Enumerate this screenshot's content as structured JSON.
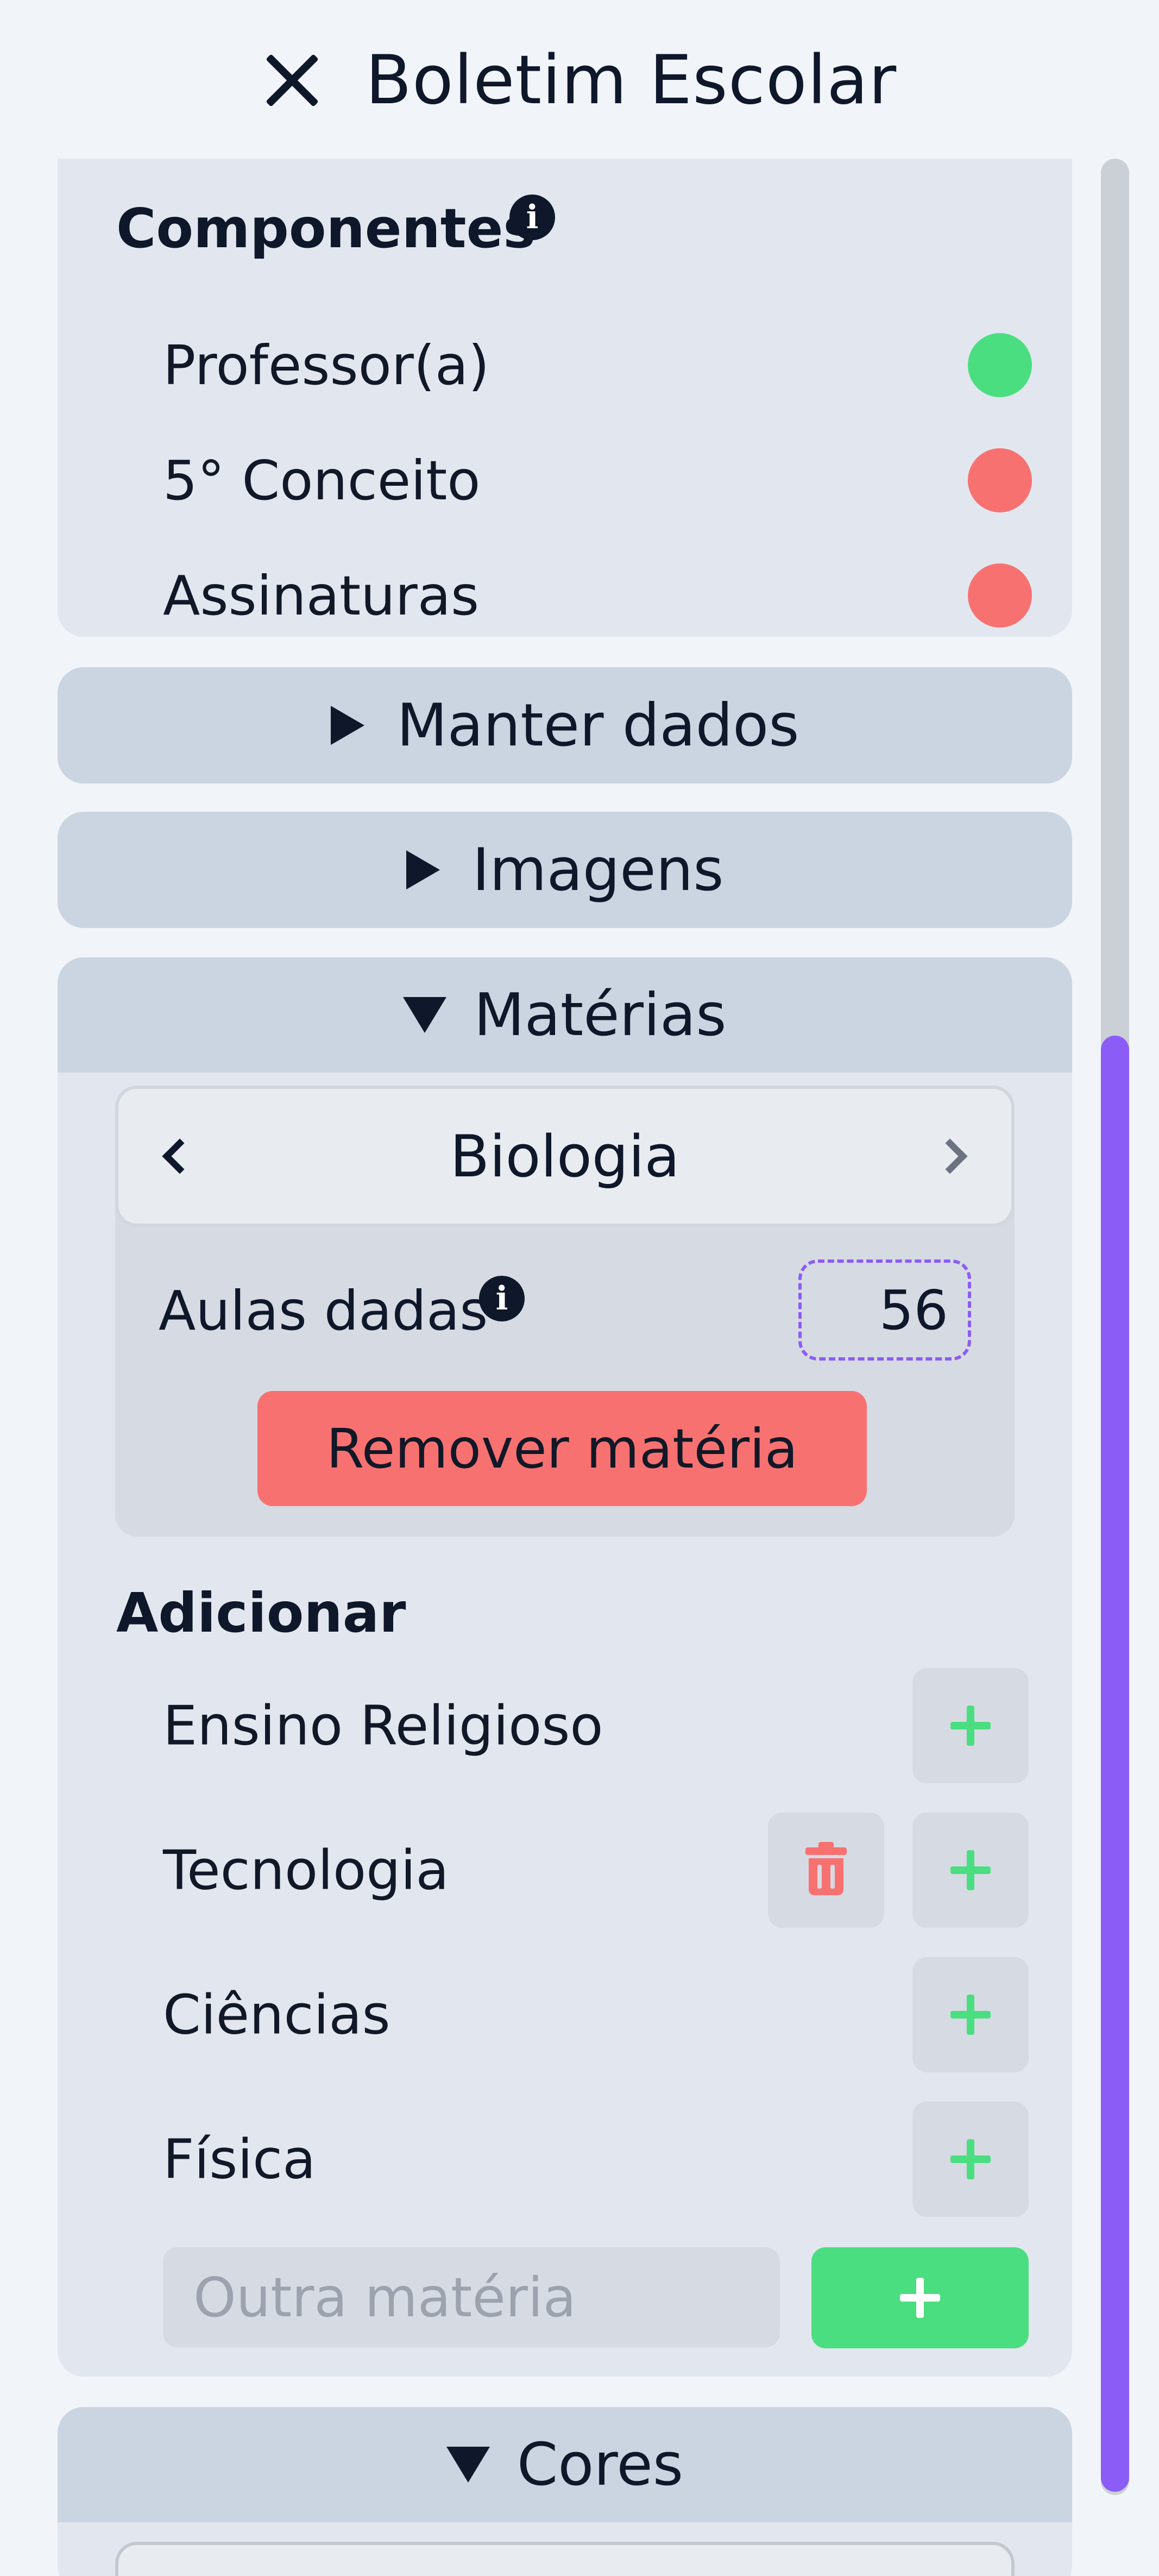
{
  "header": {
    "title": "Boletim Escolar",
    "close_icon": "close-icon"
  },
  "components": {
    "heading": "Componentes",
    "info": "i",
    "items": [
      {
        "label": "Professor(a)",
        "status": "on",
        "color": "#4ade80"
      },
      {
        "label": "5° Conceito",
        "status": "off",
        "color": "#f87171"
      },
      {
        "label": "Assinaturas",
        "status": "off",
        "color": "#f87171"
      }
    ]
  },
  "sections": {
    "manter": "Manter dados",
    "imagens": "Imagens",
    "materias": "Matérias",
    "cores": "Cores"
  },
  "materias": {
    "current_subject": "Biologia",
    "aulas_label": "Aulas dadas",
    "aulas_value": "56",
    "info": "i",
    "remove_label": "Remover matéria",
    "add_heading": "Adicionar",
    "add_items": [
      {
        "label": "Ensino Religioso",
        "deletable": false
      },
      {
        "label": "Tecnologia",
        "deletable": true
      },
      {
        "label": "Ciências",
        "deletable": false
      },
      {
        "label": "Física",
        "deletable": false
      }
    ],
    "other_placeholder": "Outra matéria"
  },
  "colors": {
    "accent": "#8b5cf6",
    "success": "#4ade80",
    "danger": "#f87171"
  }
}
